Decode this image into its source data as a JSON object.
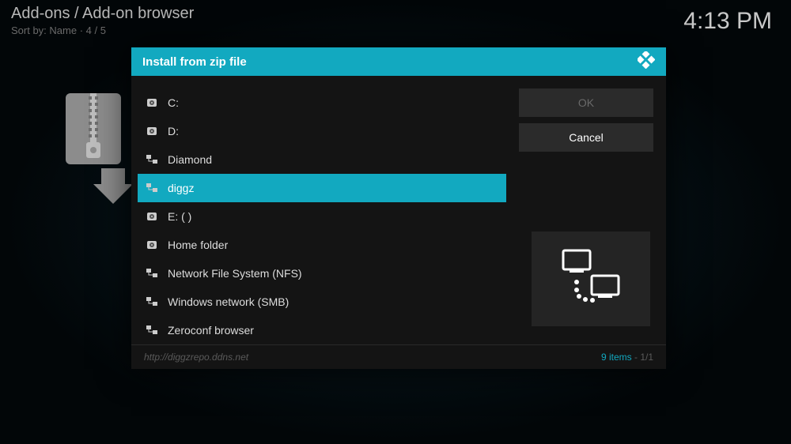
{
  "header": {
    "breadcrumb": "Add-ons / Add-on browser",
    "sort": "Sort by: Name  ·  4 / 5"
  },
  "clock": "4:13 PM",
  "dialog": {
    "title": "Install from zip file",
    "items": [
      {
        "icon": "drive",
        "label": "C:"
      },
      {
        "icon": "drive",
        "label": "D:"
      },
      {
        "icon": "network",
        "label": "Diamond"
      },
      {
        "icon": "network",
        "label": "diggz",
        "selected": true
      },
      {
        "icon": "drive",
        "label": "E: ( )"
      },
      {
        "icon": "drive",
        "label": "Home folder"
      },
      {
        "icon": "network",
        "label": "Network File System (NFS)"
      },
      {
        "icon": "network",
        "label": "Windows network (SMB)"
      },
      {
        "icon": "network",
        "label": "Zeroconf browser"
      }
    ],
    "buttons": {
      "ok": "OK",
      "cancel": "Cancel"
    },
    "footer": {
      "path": "http://diggzrepo.ddns.net",
      "count": "9 items",
      "page": "1/1"
    }
  }
}
